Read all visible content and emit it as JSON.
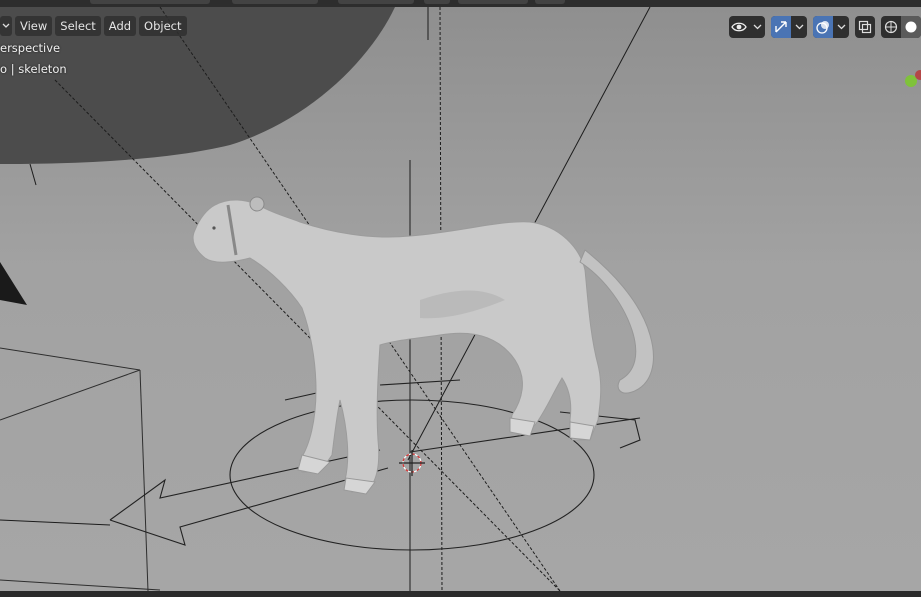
{
  "header": {
    "menu": [
      {
        "label": "View"
      },
      {
        "label": "Select"
      },
      {
        "label": "Add"
      },
      {
        "label": "Object"
      }
    ]
  },
  "viewport": {
    "view_label": "erspective",
    "collection_label": "o | skeleton"
  },
  "toolbar": {
    "icons": [
      "visibility-icon",
      "gizmo-icon",
      "overlay-icon",
      "xray-icon",
      "shading-icon"
    ]
  },
  "colors": {
    "accent": "#4a74b4",
    "header_bg": "#2d2d2d",
    "viewport_bg": "#a0a0a0",
    "gizmo_y": "#7fc23a",
    "gizmo_x": "#b34747"
  }
}
